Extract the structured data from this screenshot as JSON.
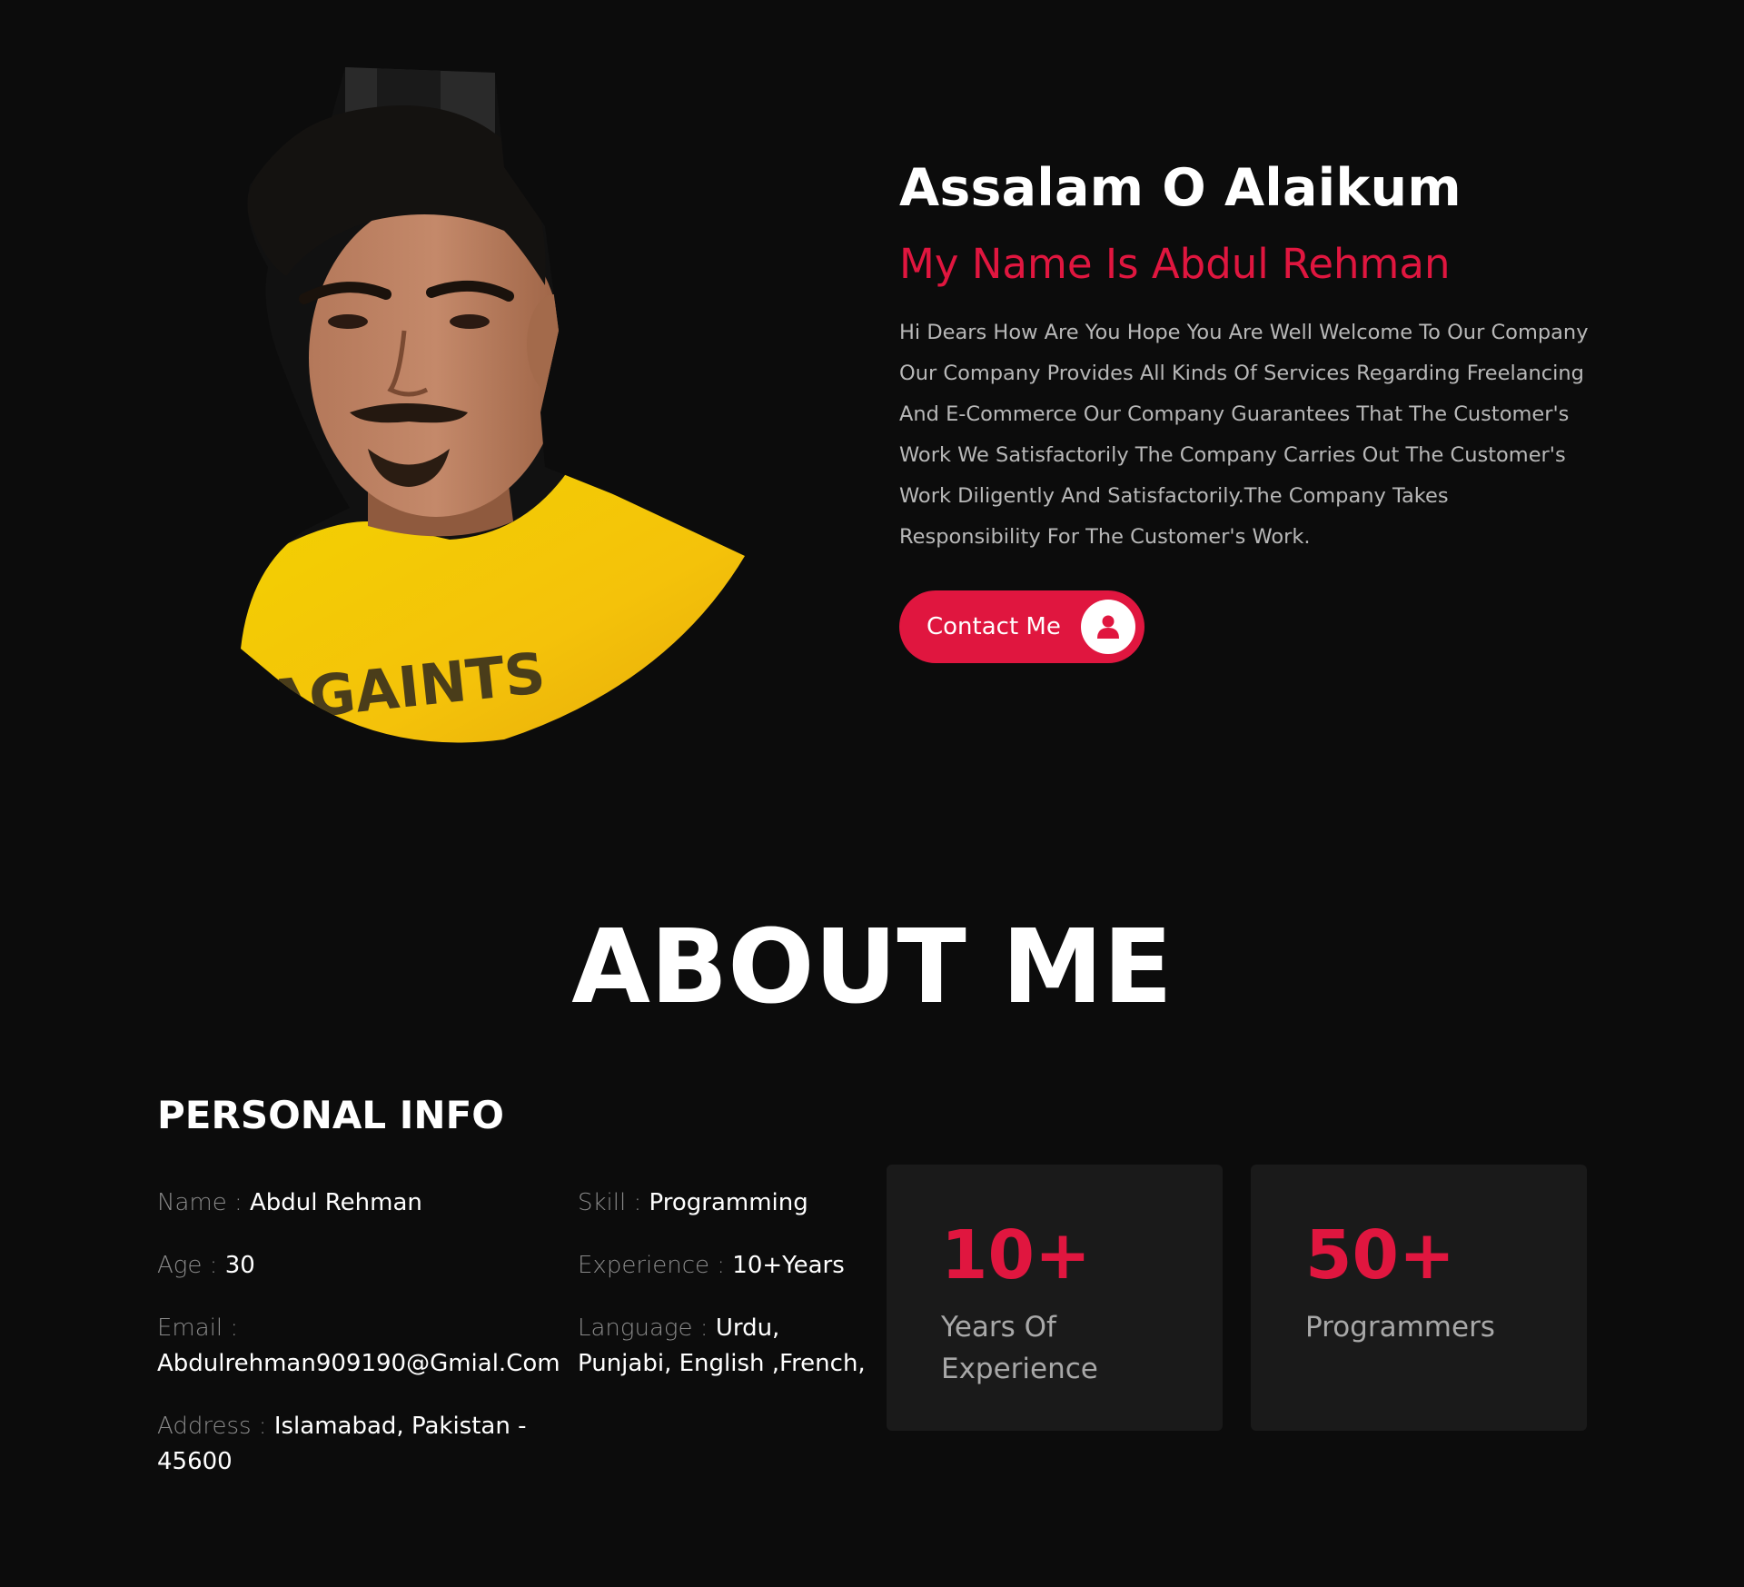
{
  "hero": {
    "greeting": "Assalam O Alaikum",
    "name_line": "My Name Is Abdul Rehman",
    "intro": "Hi Dears How Are You Hope You Are Well Welcome To Our Company Our Company Provides All Kinds Of Services Regarding Freelancing And E-Commerce Our Company Guarantees That The Customer's Work We Satisfactorily The Company Carries Out The Customer's Work Diligently And Satisfactorily.The Company Takes Responsibility For The Customer's Work.",
    "contact_label": "Contact Me",
    "contact_icon": "user-icon",
    "photo": "profile-photo",
    "photo_shirt_text": "AGAINTS"
  },
  "about": {
    "title": "ABOUT ME",
    "personal_title": "PERSONAL INFO",
    "info_left": [
      {
        "key": "Name :",
        "value": "Abdul Rehman"
      },
      {
        "key": "Age :",
        "value": "30"
      },
      {
        "key": "Email :",
        "value": "Abdulrehman909190@Gmial.Com"
      },
      {
        "key": "Address :",
        "value": "Islamabad, Pakistan - 45600"
      }
    ],
    "info_right": [
      {
        "key": "Skill :",
        "value": "Programming"
      },
      {
        "key": "Experience :",
        "value": "10+Years"
      },
      {
        "key": "Language :",
        "value": "Urdu, Punjabi, English ,French,"
      }
    ],
    "stats": [
      {
        "number": "10+",
        "label": "Years Of Experience"
      },
      {
        "number": "50+",
        "label": "Programmers"
      }
    ]
  },
  "colors": {
    "background": "#0c0c0c",
    "accent": "#e0163f",
    "card": "#1a1a1a",
    "muted_text": "#b8b8b8"
  }
}
